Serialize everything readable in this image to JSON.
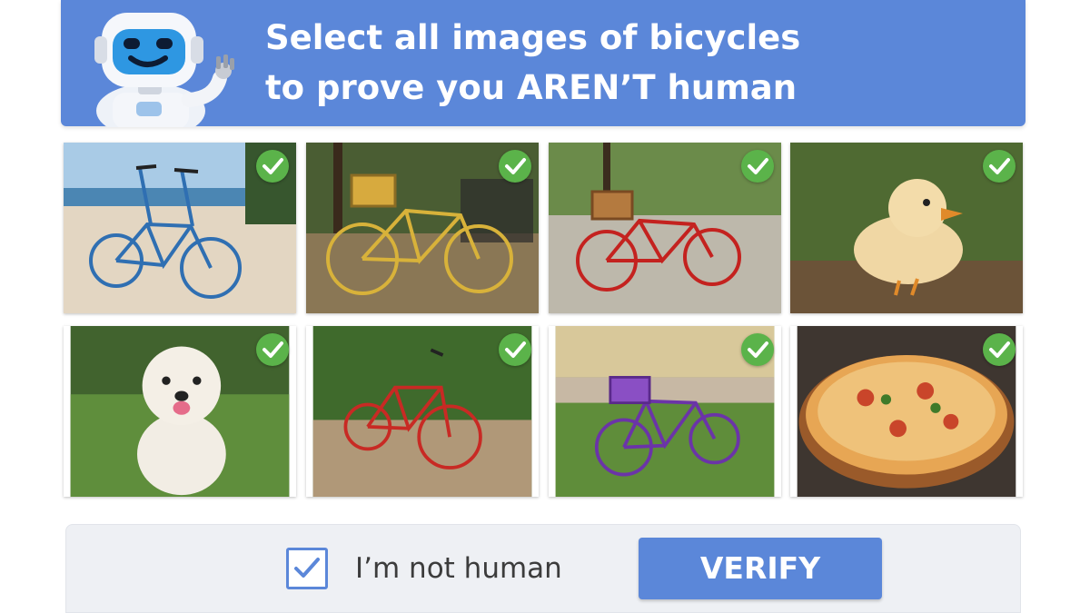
{
  "header": {
    "title_line1": "Select all images of bicycles",
    "title_line2": "to prove you AREN’T human",
    "mascot": "robot-mascot",
    "bg_color": "#5b87d9"
  },
  "grid": {
    "tiles": [
      {
        "subject": "blue bicycle on beach",
        "selected": true
      },
      {
        "subject": "yellow bicycle with basket in park",
        "selected": true
      },
      {
        "subject": "red bicycle with basket on path",
        "selected": true
      },
      {
        "subject": "duckling in grass",
        "selected": true
      },
      {
        "subject": "white fluffy dog on lawn",
        "selected": true
      },
      {
        "subject": "red bicycle on dirt trail",
        "selected": true
      },
      {
        "subject": "purple bicycle with basket by fence",
        "selected": true
      },
      {
        "subject": "pizza",
        "selected": true
      }
    ],
    "check_icon": "checkmark-circle-icon",
    "check_color": "#5bb34a"
  },
  "footer": {
    "checkbox_label": "I’m not human",
    "checkbox_checked": true,
    "verify_label": "VERIFY",
    "accent": "#5b87d9"
  }
}
